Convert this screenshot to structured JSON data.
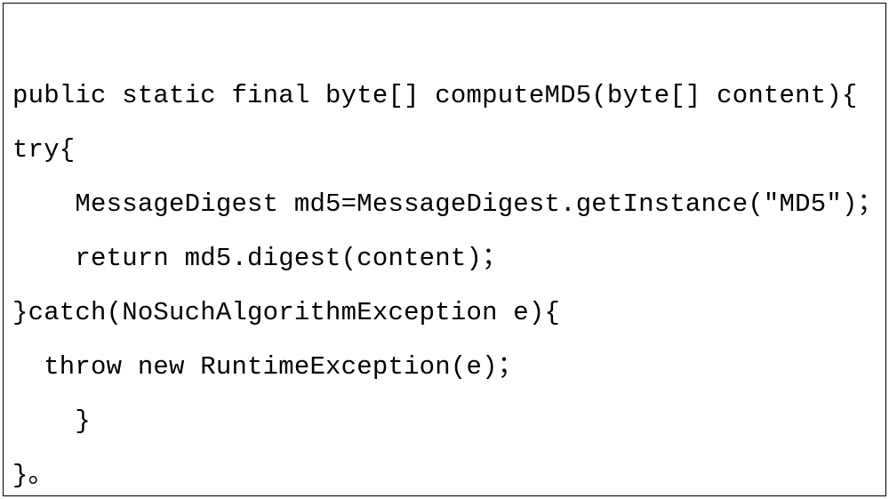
{
  "code": {
    "lines": [
      "public static final byte[] computeMD5(byte[] content){",
      "try{",
      "    MessageDigest md5=MessageDigest.getInstance(″MD5″)；",
      "    return md5.digest(content)；",
      "}catch(NoSuchAlgorithmException e){",
      "  throw new RuntimeException(e)；",
      "    }",
      "}。"
    ]
  }
}
